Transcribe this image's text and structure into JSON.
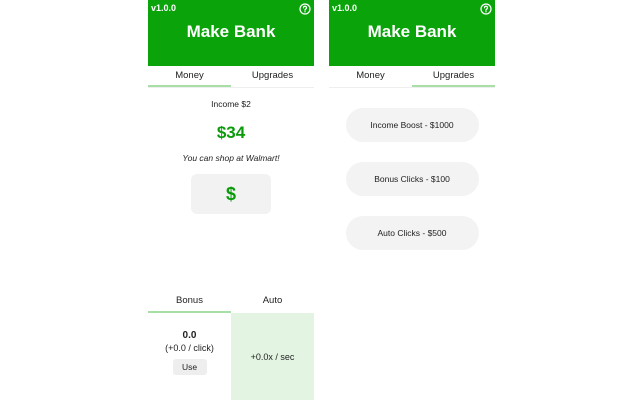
{
  "app": {
    "version": "v1.0.0",
    "title": "Make Bank",
    "help_icon": "question-circle-icon"
  },
  "colors": {
    "brand": "#0aa30a",
    "money": "#0a9a0a",
    "tab_underline": "#a7dfa7",
    "auto_bg": "#e3f4e3"
  },
  "tabs": {
    "money": "Money",
    "upgrades": "Upgrades"
  },
  "money_view": {
    "income": "Income $2",
    "balance": "$34",
    "message": "You can shop at Walmart!",
    "earn_button": "$"
  },
  "bottom_tabs": {
    "bonus": "Bonus",
    "auto": "Auto"
  },
  "bonus": {
    "value": "0.0",
    "rate": "(+0.0 / click)",
    "use_button": "Use"
  },
  "auto": {
    "rate": "+0.0x / sec"
  },
  "upgrades": [
    "Income Boost - $1000",
    "Bonus Clicks - $100",
    "Auto Clicks - $500"
  ]
}
